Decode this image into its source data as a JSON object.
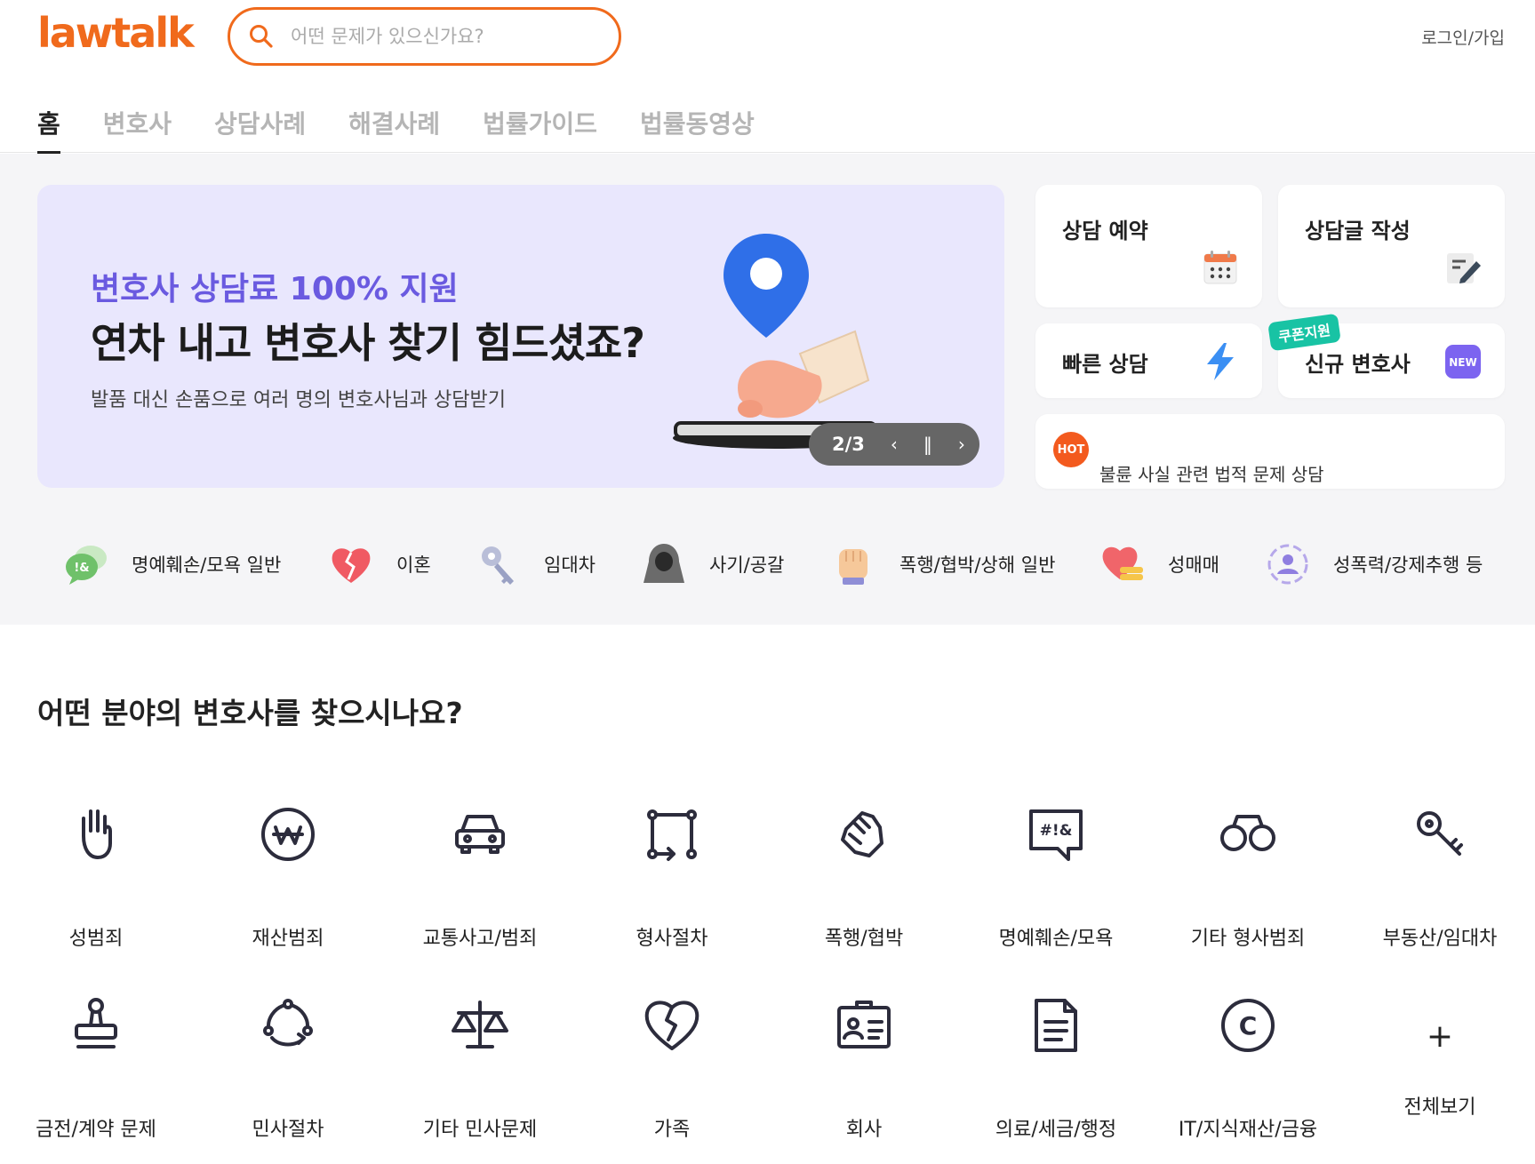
{
  "header": {
    "logo": "lawtalk",
    "search_placeholder": "어떤 문제가 있으신가요?",
    "login": "로그인/가입"
  },
  "tabs": [
    {
      "label": "홈",
      "active": true
    },
    {
      "label": "변호사",
      "active": false
    },
    {
      "label": "상담사례",
      "active": false
    },
    {
      "label": "해결사례",
      "active": false
    },
    {
      "label": "법률가이드",
      "active": false
    },
    {
      "label": "법률동영상",
      "active": false
    }
  ],
  "banner": {
    "subtitle": "변호사 상담료 100% 지원",
    "title": "연차 내고 변호사 찾기 힘드셨죠?",
    "description": "발품 대신 손품으로 여러 명의 변호사님과 상담받기",
    "pager": {
      "current": "2/3",
      "prev_icon": "chevron-left-icon",
      "pause_icon": "pause-icon",
      "next_icon": "chevron-right-icon"
    }
  },
  "quick_cards": {
    "reserve": {
      "label": "상담 예약",
      "icon": "calendar-icon"
    },
    "write": {
      "label": "상담글 작성",
      "icon": "write-icon"
    },
    "quick": {
      "label": "빠른 상담",
      "icon": "lightning-icon"
    },
    "new_lawyer": {
      "label": "신규 변호사",
      "badge": "쿠폰지원",
      "icon": "new-badge-icon",
      "icon_text": "NEW"
    },
    "hot": {
      "badge": "HOT",
      "text": "불륜 사실 관련 법적 문제 상담"
    }
  },
  "categories": [
    {
      "label": "명예훼손/모욕 일반",
      "icon": "speech-bubbles-icon"
    },
    {
      "label": "이혼",
      "icon": "broken-heart-icon"
    },
    {
      "label": "임대차",
      "icon": "key-icon"
    },
    {
      "label": "사기/공갈",
      "icon": "hooded-person-icon"
    },
    {
      "label": "폭행/협박/상해 일반",
      "icon": "fist-icon"
    },
    {
      "label": "성매매",
      "icon": "heart-coins-icon"
    },
    {
      "label": "성폭력/강제추행 등",
      "icon": "target-person-icon"
    }
  ],
  "section": {
    "title": "어떤 분야의 변호사를 찾으시나요?",
    "fields": [
      {
        "label": "성범죄",
        "icon": "hand-icon"
      },
      {
        "label": "재산범죄",
        "icon": "won-coin-icon"
      },
      {
        "label": "교통사고/범죄",
        "icon": "car-icon"
      },
      {
        "label": "형사절차",
        "icon": "procedure-icon"
      },
      {
        "label": "폭행/협박",
        "icon": "fist-icon"
      },
      {
        "label": "명예훼손/모욕",
        "icon": "speech-symbols-icon",
        "icon_text": "#!&"
      },
      {
        "label": "기타 형사범죄",
        "icon": "handcuffs-icon"
      },
      {
        "label": "부동산/임대차",
        "icon": "key-icon"
      },
      {
        "label": "금전/계약 문제",
        "icon": "stamp-icon"
      },
      {
        "label": "민사절차",
        "icon": "cycle-icon"
      },
      {
        "label": "기타 민사문제",
        "icon": "scale-icon"
      },
      {
        "label": "가족",
        "icon": "broken-heart-icon"
      },
      {
        "label": "회사",
        "icon": "id-card-icon"
      },
      {
        "label": "의료/세금/행정",
        "icon": "document-icon"
      },
      {
        "label": "IT/지식재산/금융",
        "icon": "copyright-icon",
        "icon_text": "C"
      }
    ],
    "more": {
      "label": "전체보기",
      "icon": "plus-icon",
      "icon_text": "+"
    }
  },
  "colors": {
    "brand": "#f06a1c",
    "banner_bg": "#e9e7fd",
    "accent_purple": "#6a5ae0",
    "coupon": "#18c3a4",
    "hot": "#f35a1e"
  }
}
